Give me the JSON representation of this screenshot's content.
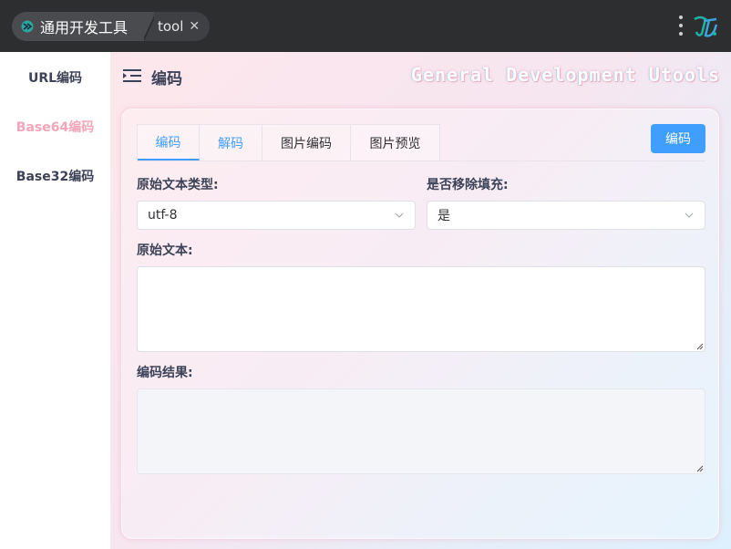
{
  "titlebar": {
    "app_title": "通用开发工具",
    "sub_tab": "tool",
    "close_glyph": "✕",
    "icons": [
      "app-logo-icon",
      "close-icon",
      "more-vert-icon",
      "brand-logo-icon"
    ]
  },
  "sidebar": {
    "items": [
      {
        "label": "URL编码",
        "active": false
      },
      {
        "label": "Base64编码",
        "active": true
      },
      {
        "label": "Base32编码",
        "active": false
      }
    ]
  },
  "header": {
    "title": "编码",
    "banner": "General Development Utools"
  },
  "tabs": [
    {
      "label": "编码",
      "active": true
    },
    {
      "label": "解码",
      "active": false
    },
    {
      "label": "图片编码",
      "active": false
    },
    {
      "label": "图片预览",
      "active": false
    }
  ],
  "actions": {
    "encode_button": "编码"
  },
  "form": {
    "encoding_label": "原始文本类型:",
    "encoding_value": "utf-8",
    "padding_label": "是否移除填充:",
    "padding_value": "是",
    "source_label": "原始文本:",
    "source_value": "",
    "result_label": "编码结果:",
    "result_value": ""
  },
  "colors": {
    "accent": "#409eff",
    "sidebar_active": "#f4a5b8",
    "text_dark": "#3c4257",
    "titlebar": "#2d2e30"
  }
}
